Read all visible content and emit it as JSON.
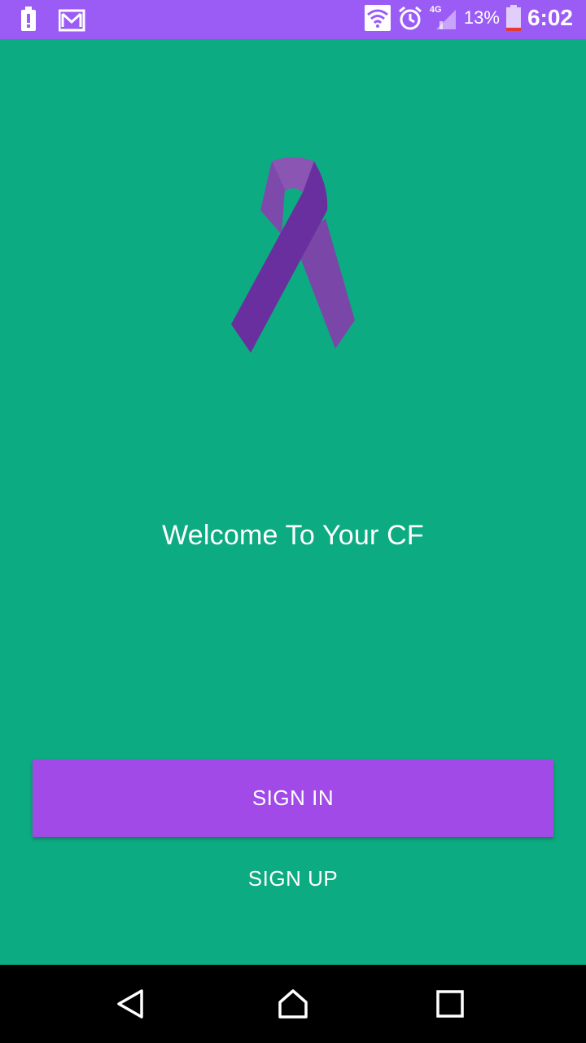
{
  "status_bar": {
    "battery_percent": "13%",
    "time": "6:02",
    "network": "4G",
    "icons": [
      "battery-alert-icon",
      "gmail-icon",
      "wifi-icon",
      "alarm-icon",
      "signal-icon",
      "battery-icon"
    ],
    "background_color": "#9b5cf6"
  },
  "main": {
    "logo_icon": "awareness-ribbon-icon",
    "welcome_text": "Welcome To Your CF",
    "background_color": "#0dab81",
    "ribbon_color": "#6f3aa0"
  },
  "actions": {
    "sign_in_label": "SIGN IN",
    "sign_up_label": "SIGN UP",
    "sign_in_color": "#a14ae8"
  },
  "nav_bar": {
    "icons": [
      "back-icon",
      "home-icon",
      "recents-icon"
    ]
  }
}
